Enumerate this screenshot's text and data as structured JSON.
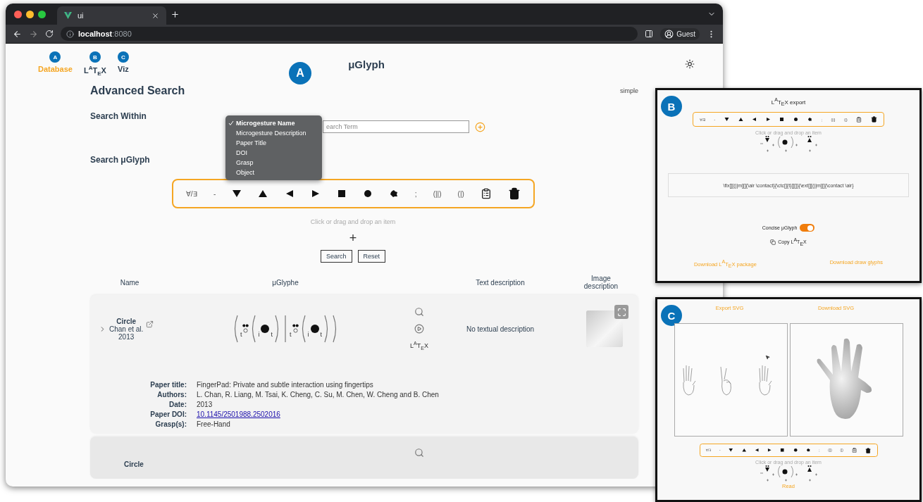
{
  "browser": {
    "tab_title": "ui",
    "address": "**localhost**:8080",
    "profile": "Guest"
  },
  "nav": [
    {
      "badge": "A",
      "label": "Database",
      "selected": true
    },
    {
      "badge": "B",
      "label": "L$^{A}$T$_{E}$X",
      "selected": false
    },
    {
      "badge": "C",
      "label": "Viz",
      "selected": false
    }
  ],
  "marker": "A",
  "title": "μGlyph",
  "search": {
    "heading": "Advanced Search",
    "mode": "simple",
    "within_label": "Search Within",
    "menu": [
      {
        "label": "Microgesture Name",
        "selected": true
      },
      {
        "label": "Microgesture Description",
        "selected": false
      },
      {
        "label": "Paper Title",
        "selected": false
      },
      {
        "label": "DOI",
        "selected": false
      },
      {
        "label": "Grasp",
        "selected": false
      },
      {
        "label": "Object",
        "selected": false
      }
    ],
    "placeholder": "earch Term",
    "glyph_label": "Search μGlyph",
    "palette": [
      {
        "kind": "text",
        "text": "∀/∃"
      },
      {
        "kind": "text",
        "text": "-"
      },
      {
        "kind": "down"
      },
      {
        "kind": "up"
      },
      {
        "kind": "left"
      },
      {
        "kind": "right"
      },
      {
        "kind": "square"
      },
      {
        "kind": "circle"
      },
      {
        "kind": "blob"
      },
      {
        "kind": "text",
        "text": ";"
      },
      {
        "kind": "text",
        "text": "(||)"
      },
      {
        "kind": "text",
        "text": "(|)"
      },
      {
        "kind": "clipboard"
      },
      {
        "kind": "trash"
      }
    ],
    "hint": "Click or drag and drop an item",
    "add": "+",
    "buttons": [
      "Search",
      "Reset"
    ]
  },
  "table": {
    "columns": [
      "Name",
      "μGlyphe",
      "Text description",
      "Image description"
    ],
    "rows": [
      {
        "name": "Circle",
        "authors": "Chan et al.",
        "year": "2013",
        "latex": "L$^{A}$T$_{E}$X",
        "text_description": "No textual description",
        "formula": [
          {
            "kind": "open"
          },
          {
            "kind": "sub",
            "text": "t"
          },
          {
            "kind": "marks"
          },
          {
            "kind": "open"
          },
          {
            "kind": "sub",
            "text": "i"
          },
          {
            "kind": "dot"
          },
          {
            "kind": "sub",
            "text": "t"
          },
          {
            "kind": "close"
          },
          {
            "kind": "sep"
          },
          {
            "kind": "sub",
            "text": "t"
          },
          {
            "kind": "marks"
          },
          {
            "kind": "open"
          },
          {
            "kind": "sub",
            "text": "i"
          },
          {
            "kind": "dot"
          },
          {
            "kind": "sub",
            "text": "t"
          },
          {
            "kind": "close"
          },
          {
            "kind": "close"
          }
        ],
        "details": [
          {
            "label": "Paper title:",
            "value": "FingerPad: Private and subtle interaction using fingertips",
            "kind": "text"
          },
          {
            "label": "Authors:",
            "value": "L. Chan, R. Liang, M. Tsai, K. Cheng, C. Su, M. Chen, W. Cheng and B. Chen",
            "kind": "text"
          },
          {
            "label": "Date:",
            "value": "2013",
            "kind": "text"
          },
          {
            "label": "Paper DOI:",
            "value": "10.1145/2501988.2502016",
            "kind": "link"
          },
          {
            "label": "Grasp(s):",
            "value": "Free-Hand",
            "kind": "text"
          }
        ]
      },
      {
        "name": "Circle"
      }
    ]
  },
  "latex_panel": {
    "badge": "B",
    "title": "L$^{A}$T$_{E}$X export",
    "palette": [
      {
        "kind": "text",
        "text": "∀/∃"
      },
      {
        "kind": "text",
        "text": "-"
      },
      {
        "kind": "down"
      },
      {
        "kind": "up"
      },
      {
        "kind": "left"
      },
      {
        "kind": "right"
      },
      {
        "kind": "square"
      },
      {
        "kind": "circle"
      },
      {
        "kind": "blob"
      },
      {
        "kind": "text",
        "text": ";"
      },
      {
        "kind": "text",
        "text": "(||)"
      },
      {
        "kind": "text",
        "text": "(|)"
      },
      {
        "kind": "clipboard"
      },
      {
        "kind": "trash"
      }
    ],
    "hint": "Click or drag and drop an item",
    "code": "\\flx[][(||m][]{\\air \\contact}{\\ctc[]{t}[][]}{\\ext[][(||m][]{\\contact \\air}",
    "toggle": {
      "label": "Concise μGlyph",
      "on": true
    },
    "copy": "Copy L$^{A}$T$_{E}$X",
    "links": [
      "Download L$^{A}$T$_{E}$X package",
      "Download draw glyphs"
    ]
  },
  "viz_panel": {
    "badge": "C",
    "links": [
      "Export SVG",
      "Download SVG"
    ],
    "palette": [
      {
        "kind": "text",
        "text": "∀/∃"
      },
      {
        "kind": "text",
        "text": "-"
      },
      {
        "kind": "down"
      },
      {
        "kind": "up"
      },
      {
        "kind": "left"
      },
      {
        "kind": "right"
      },
      {
        "kind": "square"
      },
      {
        "kind": "circle"
      },
      {
        "kind": "blob"
      },
      {
        "kind": "text",
        "text": ";"
      },
      {
        "kind": "text",
        "text": "(||)"
      },
      {
        "kind": "text",
        "text": "(|)"
      },
      {
        "kind": "clipboard"
      },
      {
        "kind": "trash"
      }
    ],
    "hint": "Click or drag and drop an item",
    "action": "Read"
  }
}
